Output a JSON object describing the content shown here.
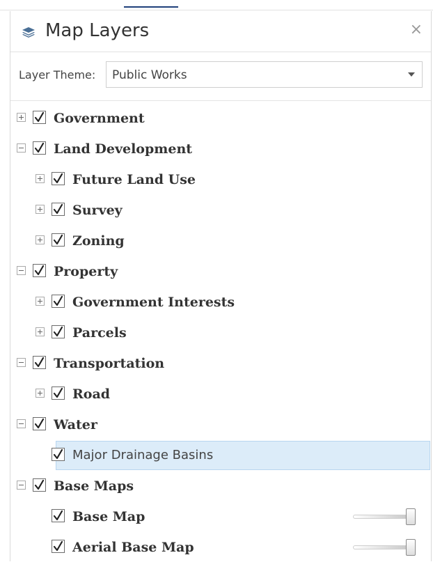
{
  "panel": {
    "title": "Map Layers",
    "close_symbol": "×",
    "icon": "layers-icon",
    "close_icon": "close-icon"
  },
  "theme": {
    "label": "Layer Theme:",
    "selected": "Public Works"
  },
  "layers": [
    {
      "label": "Government",
      "level": 0,
      "expander": "plus",
      "checked": true
    },
    {
      "label": "Land Development",
      "level": 0,
      "expander": "minus",
      "checked": true
    },
    {
      "label": "Future Land Use",
      "level": 1,
      "expander": "plus",
      "checked": true
    },
    {
      "label": "Survey",
      "level": 1,
      "expander": "plus",
      "checked": true
    },
    {
      "label": "Zoning",
      "level": 1,
      "expander": "plus",
      "checked": true
    },
    {
      "label": "Property",
      "level": 0,
      "expander": "minus",
      "checked": true
    },
    {
      "label": "Government Interests",
      "level": 1,
      "expander": "plus",
      "checked": true
    },
    {
      "label": "Parcels",
      "level": 1,
      "expander": "plus",
      "checked": true
    },
    {
      "label": "Transportation",
      "level": 0,
      "expander": "minus",
      "checked": true
    },
    {
      "label": "Road",
      "level": 1,
      "expander": "plus",
      "checked": true
    },
    {
      "label": "Water",
      "level": 0,
      "expander": "minus",
      "checked": true
    },
    {
      "label": "Major Drainage Basins",
      "level": 1,
      "expander": "none",
      "checked": true,
      "selected": true,
      "plain": true
    },
    {
      "label": "Base Maps",
      "level": 0,
      "expander": "minus",
      "checked": true
    },
    {
      "label": "Base Map",
      "level": 1,
      "expander": "none",
      "checked": true,
      "opacity": 1.0
    },
    {
      "label": "Aerial Base Map",
      "level": 1,
      "expander": "none",
      "checked": true,
      "opacity": 1.0
    }
  ],
  "colors": {
    "selected_bg": "#dcecf9",
    "accent": "#1e3f7a"
  }
}
